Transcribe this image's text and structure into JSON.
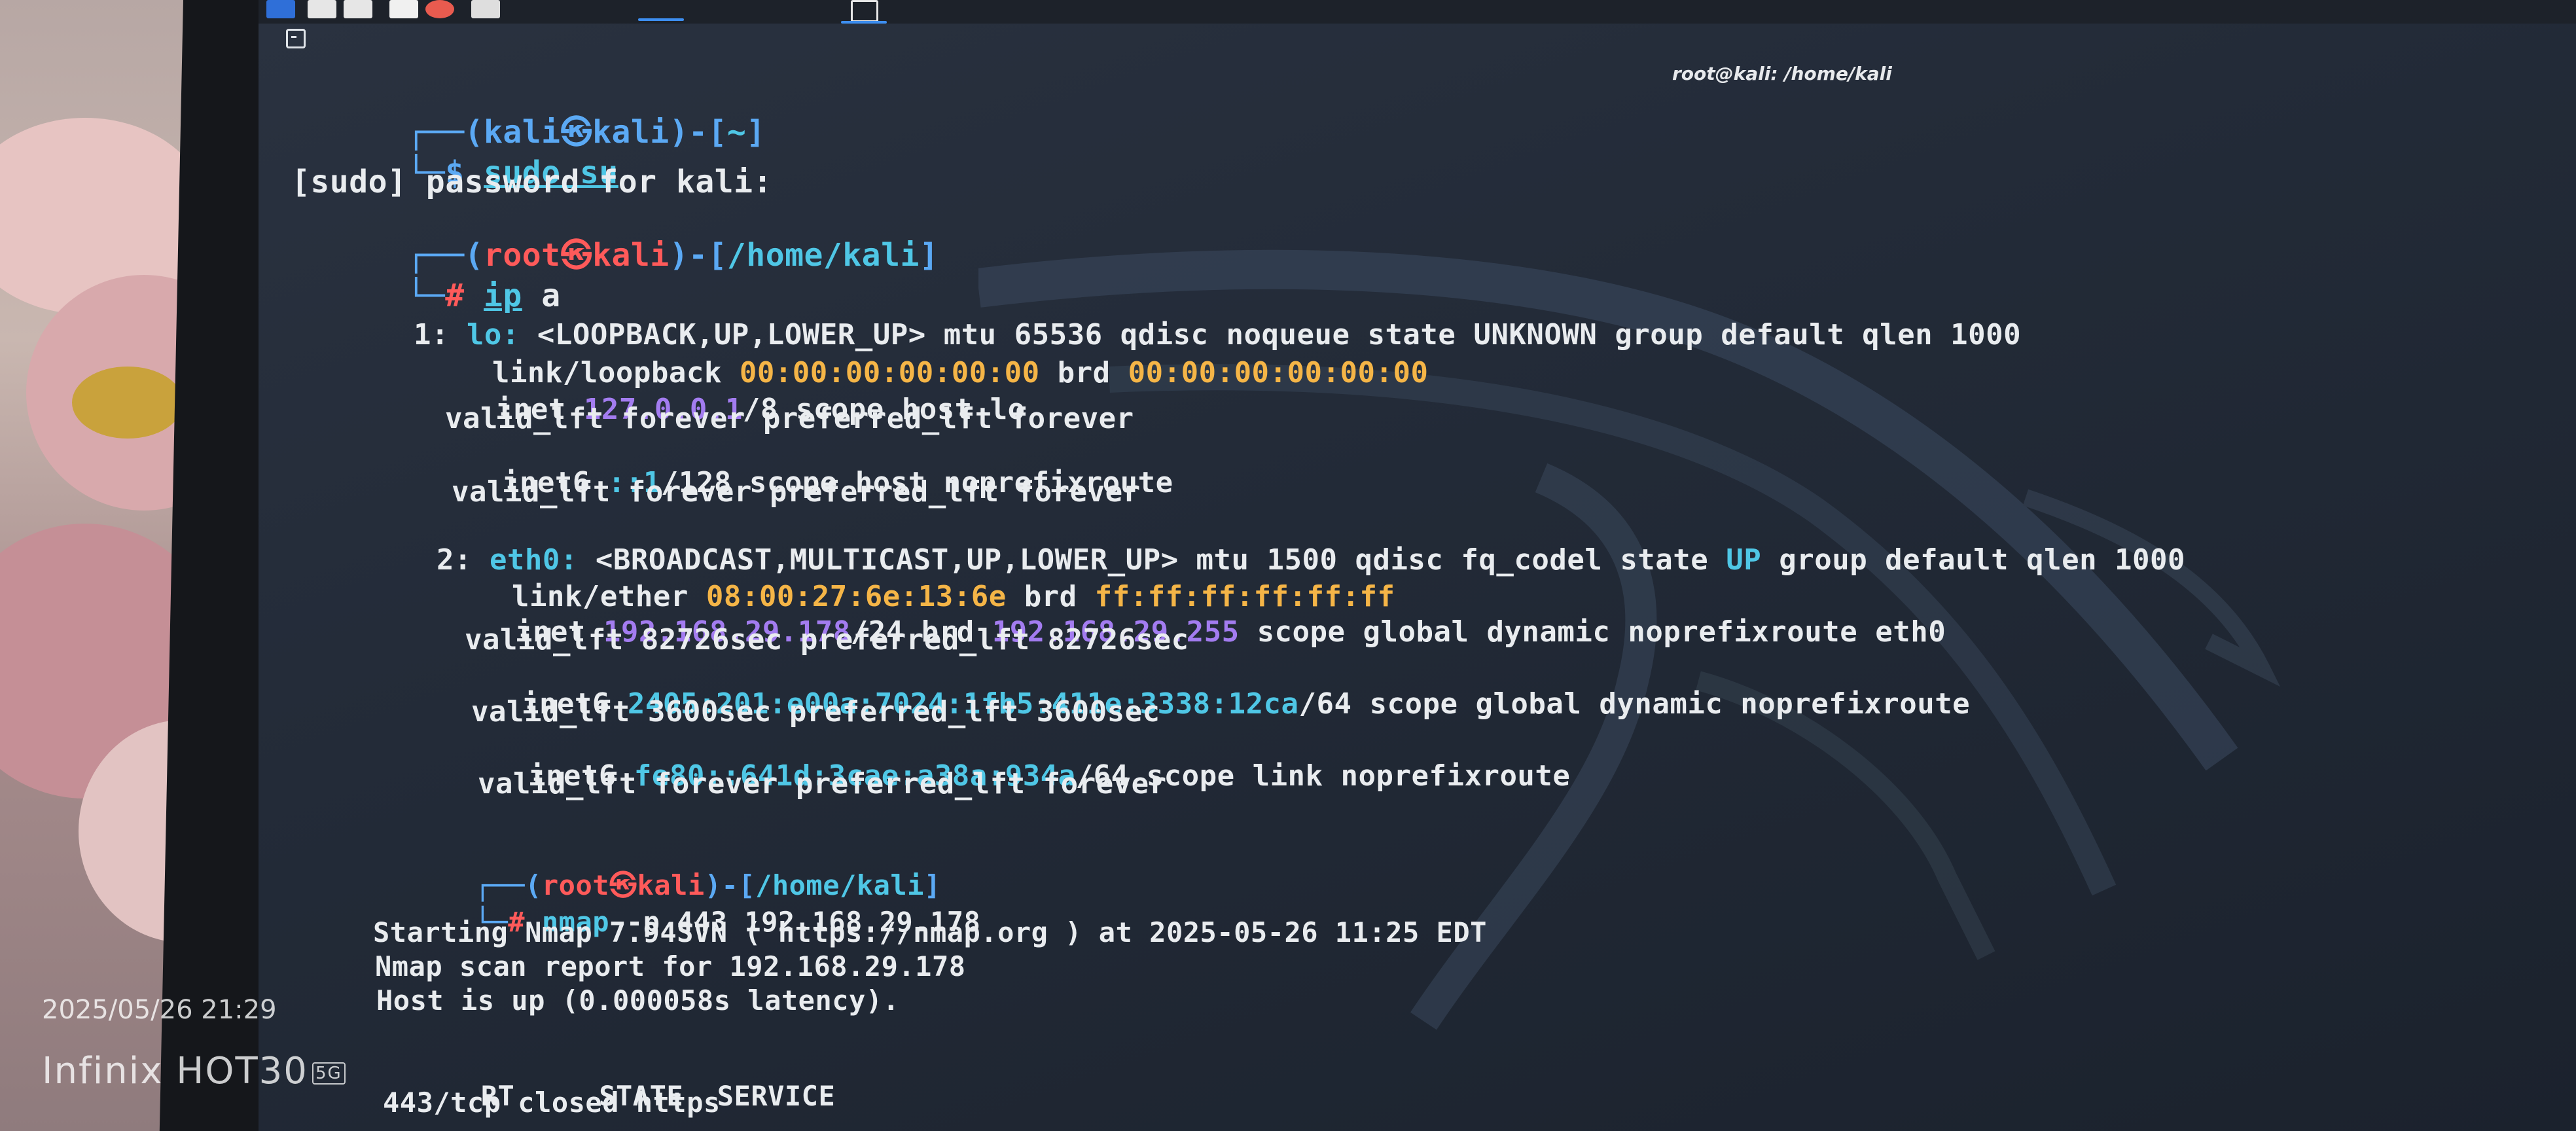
{
  "window": {
    "title": "root@kali: /home/kali"
  },
  "watermark": {
    "datetime": "2025/05/26 21:29",
    "brand": "Infinix HOT30",
    "network_badge": "5G"
  },
  "terminal": {
    "prompt1": {
      "box": "┌──(",
      "user": "kali",
      "at": "㉿",
      "host": "kali",
      "mid": ")-[",
      "path": "~",
      "end": "]"
    },
    "cmd1": {
      "box": "└─",
      "sym": "$",
      "cmd": "sudo su"
    },
    "sudo_prompt": "[sudo] password for kali:",
    "prompt2": {
      "box": "┌──(",
      "user": "root",
      "at": "㉿",
      "host": "kali",
      "mid": ")-[",
      "path": "/home/kali",
      "end": "]"
    },
    "cmd2": {
      "box": "└─",
      "sym": "#",
      "cmd": "ip",
      "arg": " a"
    },
    "ipa": {
      "l1_pre": "1: ",
      "l1_if": "lo:",
      "l1_rest": " <LOOPBACK,UP,LOWER_UP> mtu 65536 qdisc noqueue state UNKNOWN group default qlen 1000",
      "l2_pre": "link/loopback ",
      "l2_mac": "00:00:00:00:00:00",
      "l2_mid": " brd ",
      "l2_brd": "00:00:00:00:00:00",
      "l3_pre": "inet ",
      "l3_ip": "127.0.0.1",
      "l3_rest": "/8 scope host lo",
      "l4": "valid_lft forever preferred_lft forever",
      "l5_pre": "inet6 ",
      "l5_ip": "::1",
      "l5_rest": "/128 scope host noprefixroute",
      "l6": "valid_lft forever preferred_lft forever",
      "l7_pre": "2: ",
      "l7_if": "eth0:",
      "l7_mid": " <BROADCAST,MULTICAST,UP,LOWER_UP> mtu 1500 qdisc fq_codel state ",
      "l7_state": "UP",
      "l7_rest": " group default qlen 1000",
      "l8_pre": "link/ether ",
      "l8_mac": "08:00:27:6e:13:6e",
      "l8_mid": " brd ",
      "l8_brd": "ff:ff:ff:ff:ff:ff",
      "l9_pre": "inet ",
      "l9_ip": "192.168.29.178",
      "l9_mid": "/24 brd ",
      "l9_brd": "192.168.29.255",
      "l9_rest": " scope global dynamic noprefixroute eth0",
      "l10": "valid_lft 82726sec preferred_lft 82726sec",
      "l11_pre": "inet6 ",
      "l11_ip": "2405:201:e00a:7024:1fb5:411e:3338:12ca",
      "l11_rest": "/64 scope global dynamic noprefixroute",
      "l12": "valid_lft 3600sec preferred_lft 3600sec",
      "l13_pre": "inet6 ",
      "l13_ip": "fe80::641d:3cae:a38a:934a",
      "l13_rest": "/64 scope link noprefixroute",
      "l14": "valid_lft forever preferred_lft forever"
    },
    "prompt3": {
      "box": "┌──(",
      "user": "root",
      "at": "㉿",
      "host": "kali",
      "mid": ")-[",
      "path": "/home/kali",
      "end": "]"
    },
    "cmd3": {
      "box": "└─",
      "sym": "#",
      "cmd": "nmap",
      "arg": " -p 443 192.168.29.178"
    },
    "nmap": {
      "l1": "Starting Nmap 7.94SVN ( https://nmap.org ) at 2025-05-26 11:25 EDT",
      "l2": "Nmap scan report for 192.168.29.178",
      "l3": "Host is up (0.000058s latency).",
      "l4_port": "RT",
      "l4_state": "STATE",
      "l4_service": "SERVICE",
      "l5": "443/tcp closed https"
    }
  }
}
